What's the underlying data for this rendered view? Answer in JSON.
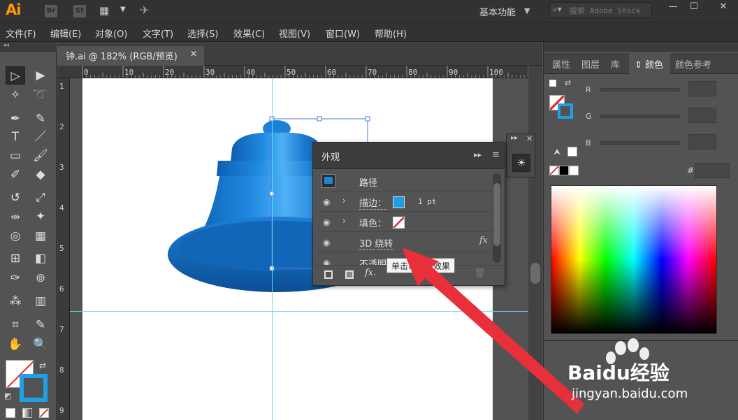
{
  "app": {
    "logo": "Ai",
    "bridge_btn": "Br",
    "stock_btn": "St",
    "workspace": "基本功能",
    "search_placeholder": "搜索 Adobe Stock"
  },
  "menu": [
    "文件(F)",
    "编辑(E)",
    "对象(O)",
    "文字(T)",
    "选择(S)",
    "效果(C)",
    "视图(V)",
    "窗口(W)",
    "帮助(H)"
  ],
  "document": {
    "tab_title": "钟.ai @ 182% (RGB/预览)",
    "ruler_x": [
      "0",
      "10",
      "20",
      "30",
      "40",
      "50",
      "60",
      "70",
      "80",
      "90",
      "100"
    ],
    "ruler_y": [
      "1",
      "2",
      "3",
      "4",
      "5",
      "6",
      "7",
      "8",
      "9"
    ]
  },
  "appearance_panel": {
    "title": "外观",
    "path_label": "路径",
    "stroke_label": "描边：",
    "stroke_value": "1 pt",
    "fill_label": "填色：",
    "effect_label": "3D 绕转",
    "opacity_label": "不透明度",
    "tooltip": "单击以编辑效果",
    "fx_icon": "fx"
  },
  "right_panel": {
    "tabs": [
      "属性",
      "图层",
      "库",
      "颜色",
      "颜色参考"
    ],
    "active_tab": "颜色",
    "channels": [
      "R",
      "G",
      "B"
    ],
    "hex_label": "#"
  },
  "colors": {
    "bell_blue": "#1e88d8",
    "stroke_blue": "#1ea0e6",
    "guide": "#5fe0f0",
    "arrow_red": "#e8303a"
  },
  "watermark": {
    "brand": "Baidu经验",
    "url": "jingyan.baidu.com"
  }
}
